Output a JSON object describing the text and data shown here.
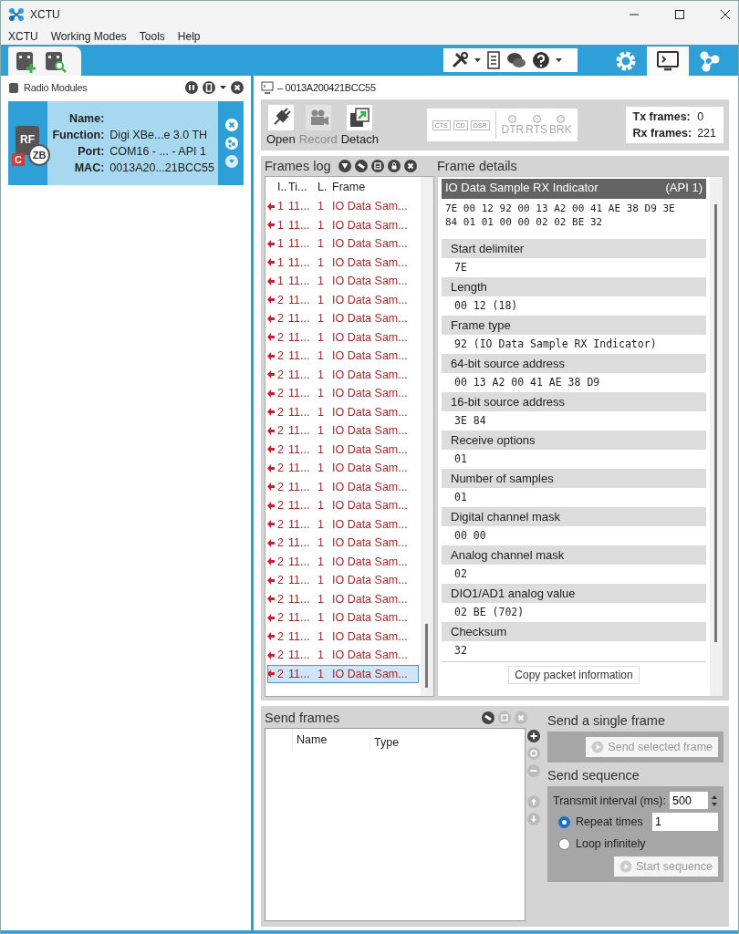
{
  "window": {
    "title": "XCTU"
  },
  "menu": [
    "XCTU",
    "Working Modes",
    "Tools",
    "Help"
  ],
  "mode_tabs": [
    {
      "kind": "configuration",
      "selected": false
    },
    {
      "kind": "consoles",
      "selected": true
    },
    {
      "kind": "network",
      "selected": false
    }
  ],
  "radio_modules": {
    "title": "Radio Modules",
    "modules": [
      {
        "selected": true,
        "badge_a": "RF",
        "badge_b": "ZB",
        "badge_c": "C",
        "fields": [
          {
            "label": "Name:"
          },
          {
            "label": "Function:",
            "value": "Digi XBe...e 3.0 TH"
          },
          {
            "label": "Port:",
            "value": "COM16 - ... - API 1"
          },
          {
            "label": "MAC:",
            "value": "0013A20...21BCC55"
          }
        ]
      }
    ]
  },
  "console": {
    "title": "– 0013A200421BCC55",
    "actions": [
      {
        "label": "Open",
        "disabled": false
      },
      {
        "label": "Record",
        "disabled": true
      },
      {
        "label": "Detach",
        "disabled": false
      }
    ],
    "line_signals": [
      "CTS",
      "CD",
      "DSR"
    ],
    "line_controls": [
      {
        "label": "DTR",
        "on": false
      },
      {
        "label": "RTS",
        "on": false
      },
      {
        "label": "BRK",
        "on": false
      }
    ],
    "counters": [
      {
        "label": "Tx frames:",
        "value": "0"
      },
      {
        "label": "Rx frames:",
        "value": "221"
      }
    ]
  },
  "frames_log": {
    "title": "Frames log",
    "columns": [
      "I..",
      "Ti...",
      "L.",
      "Frame"
    ],
    "rows": [
      {
        "id": "1",
        "time": "11...",
        "length": "1",
        "frame": "IO Data Sam...",
        "selected": false
      },
      {
        "id": "1",
        "time": "11...",
        "length": "1",
        "frame": "IO Data Sam...",
        "selected": false
      },
      {
        "id": "1",
        "time": "11...",
        "length": "1",
        "frame": "IO Data Sam...",
        "selected": false
      },
      {
        "id": "1",
        "time": "11...",
        "length": "1",
        "frame": "IO Data Sam...",
        "selected": false
      },
      {
        "id": "1",
        "time": "11...",
        "length": "1",
        "frame": "IO Data Sam...",
        "selected": false
      },
      {
        "id": "2",
        "time": "11...",
        "length": "1",
        "frame": "IO Data Sam...",
        "selected": false
      },
      {
        "id": "2",
        "time": "11...",
        "length": "1",
        "frame": "IO Data Sam...",
        "selected": false
      },
      {
        "id": "2",
        "time": "11...",
        "length": "1",
        "frame": "IO Data Sam...",
        "selected": false
      },
      {
        "id": "2",
        "time": "11...",
        "length": "1",
        "frame": "IO Data Sam...",
        "selected": false
      },
      {
        "id": "2",
        "time": "11...",
        "length": "1",
        "frame": "IO Data Sam...",
        "selected": false
      },
      {
        "id": "2",
        "time": "11...",
        "length": "1",
        "frame": "IO Data Sam...",
        "selected": false
      },
      {
        "id": "2",
        "time": "11...",
        "length": "1",
        "frame": "IO Data Sam...",
        "selected": false
      },
      {
        "id": "2",
        "time": "11...",
        "length": "1",
        "frame": "IO Data Sam...",
        "selected": false
      },
      {
        "id": "2",
        "time": "11...",
        "length": "1",
        "frame": "IO Data Sam...",
        "selected": false
      },
      {
        "id": "2",
        "time": "11...",
        "length": "1",
        "frame": "IO Data Sam...",
        "selected": false
      },
      {
        "id": "2",
        "time": "11...",
        "length": "1",
        "frame": "IO Data Sam...",
        "selected": false
      },
      {
        "id": "2",
        "time": "11...",
        "length": "1",
        "frame": "IO Data Sam...",
        "selected": false
      },
      {
        "id": "2",
        "time": "11...",
        "length": "1",
        "frame": "IO Data Sam...",
        "selected": false
      },
      {
        "id": "2",
        "time": "11...",
        "length": "1",
        "frame": "IO Data Sam...",
        "selected": false
      },
      {
        "id": "2",
        "time": "11...",
        "length": "1",
        "frame": "IO Data Sam...",
        "selected": false
      },
      {
        "id": "2",
        "time": "11...",
        "length": "1",
        "frame": "IO Data Sam...",
        "selected": false
      },
      {
        "id": "2",
        "time": "11...",
        "length": "1",
        "frame": "IO Data Sam...",
        "selected": false
      },
      {
        "id": "2",
        "time": "11...",
        "length": "1",
        "frame": "IO Data Sam...",
        "selected": false
      },
      {
        "id": "2",
        "time": "11...",
        "length": "1",
        "frame": "IO Data Sam...",
        "selected": false
      },
      {
        "id": "2",
        "time": "11...",
        "length": "1",
        "frame": "IO Data Sam...",
        "selected": false
      },
      {
        "id": "2",
        "time": "11...",
        "length": "1",
        "frame": "IO Data Sam...",
        "selected": true
      }
    ]
  },
  "frame_details": {
    "title": "Frame details",
    "header": "IO Data Sample RX Indicator",
    "api": "(API 1)",
    "hex_lines": [
      "7E 00 12 92 00 13 A2 00 41 AE 38 D9 3E",
      "84 01 01 00 00 02 02 BE 32"
    ],
    "fields": [
      {
        "label": "Start delimiter",
        "value": "7E"
      },
      {
        "label": "Length",
        "value": "00 12 (18)"
      },
      {
        "label": "Frame type",
        "value": "92 (IO Data Sample RX Indicator)"
      },
      {
        "label": "64-bit source address",
        "value": "00 13 A2 00 41 AE 38 D9"
      },
      {
        "label": "16-bit source address",
        "value": "3E 84"
      },
      {
        "label": "Receive options",
        "value": "01"
      },
      {
        "label": "Number of samples",
        "value": "01"
      },
      {
        "label": "Digital channel mask",
        "value": "00 00"
      },
      {
        "label": "Analog channel mask",
        "value": "02"
      },
      {
        "label": "DIO1/AD1 analog value",
        "value": "02 BE (702)"
      },
      {
        "label": "Checksum",
        "value": "32"
      }
    ],
    "copy_button": "Copy packet information"
  },
  "send_frames": {
    "title": "Send frames",
    "columns": [
      "Name",
      "Type"
    ]
  },
  "send_single": {
    "title": "Send a single frame",
    "button": {
      "label": "Send selected frame",
      "disabled": true
    }
  },
  "send_sequence": {
    "title": "Send sequence",
    "interval_label": "Transmit interval (ms):",
    "interval": "500",
    "options": [
      {
        "label": "Repeat times",
        "selected": true,
        "value": "1"
      },
      {
        "label": "Loop infinitely",
        "selected": false
      }
    ],
    "button": {
      "label": "Start sequence",
      "disabled": true
    }
  }
}
